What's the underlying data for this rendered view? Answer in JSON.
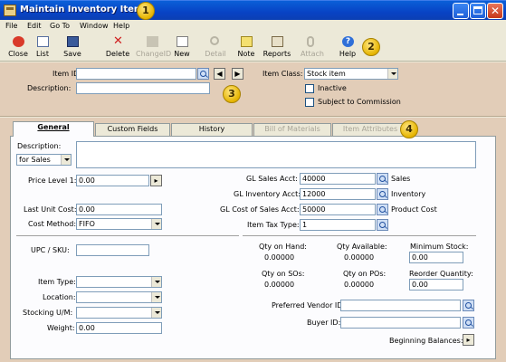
{
  "window": {
    "title": "Maintain Inventory Items"
  },
  "callouts": [
    "1",
    "2",
    "3",
    "4"
  ],
  "menu": [
    "File",
    "Edit",
    "Go To",
    "Window",
    "Help"
  ],
  "toolbar": {
    "close": "Close",
    "list": "List",
    "save": "Save",
    "delete": "Delete",
    "changeid": "ChangeID",
    "new": "New",
    "detail": "Detail",
    "note": "Note",
    "reports": "Reports",
    "attach": "Attach",
    "help": "Help"
  },
  "header": {
    "item_id_label": "Item ID:",
    "item_id_value": "",
    "description_label": "Description:",
    "description_value": "",
    "item_class_label": "Item Class:",
    "item_class_value": "Stock item",
    "inactive_label": "Inactive",
    "subject_commission_label": "Subject to Commission"
  },
  "tabs": [
    "General",
    "Custom Fields",
    "History",
    "Bill of Materials",
    "Item Attributes"
  ],
  "general": {
    "description_label": "Description:",
    "description_for": "for Sales",
    "price_level_label": "Price Level 1:",
    "price_level_value": "0.00",
    "last_unit_cost_label": "Last Unit Cost:",
    "last_unit_cost_value": "0.00",
    "cost_method_label": "Cost Method:",
    "cost_method_value": "FIFO",
    "upc_label": "UPC / SKU:",
    "upc_value": "",
    "item_type_label": "Item Type:",
    "location_label": "Location:",
    "stocking_um_label": "Stocking U/M:",
    "weight_label": "Weight:",
    "weight_value": "0.00",
    "gl_sales_label": "GL Sales Acct:",
    "gl_sales_value": "40000",
    "gl_sales_desc": "Sales",
    "gl_inventory_label": "GL Inventory Acct:",
    "gl_inventory_value": "12000",
    "gl_inventory_desc": "Inventory",
    "gl_cost_label": "GL Cost of Sales Acct:",
    "gl_cost_value": "50000",
    "gl_cost_desc": "Product Cost",
    "item_tax_label": "Item Tax Type:",
    "item_tax_value": "1",
    "qty_on_hand_label": "Qty on Hand:",
    "qty_on_hand_value": "0.00000",
    "qty_available_label": "Qty Available:",
    "qty_available_value": "0.00000",
    "min_stock_label": "Minimum Stock:",
    "min_stock_value": "0.00",
    "qty_sos_label": "Qty on SOs:",
    "qty_sos_value": "0.00000",
    "qty_pos_label": "Qty on POs:",
    "qty_pos_value": "0.00000",
    "reorder_qty_label": "Reorder Quantity:",
    "reorder_qty_value": "0.00",
    "preferred_vendor_label": "Preferred Vendor ID:",
    "buyer_id_label": "Buyer ID:",
    "beginning_balances_label": "Beginning Balances:"
  }
}
